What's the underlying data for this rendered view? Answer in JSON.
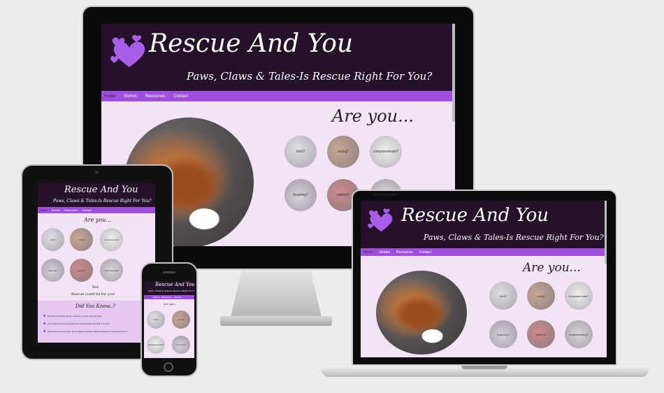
{
  "site": {
    "title": "Rescue And You",
    "tagline": "Paws, Claws & Tales-Is Rescue Right For You?",
    "nav": [
      "Home",
      "Stories",
      "Resources",
      "Contact"
    ],
    "are_you": "Are you...",
    "circles": [
      "kind?",
      "caring?",
      "compassionate?",
      "forgiving?",
      "patient?",
      "understanding?"
    ],
    "but": "But",
    "rescue_could_be": "Rescue could be for you!",
    "did_you_know": "Did You Know..?",
    "facts": [
      "All sorts of animals can be rescued, not just cats and dogs!",
      "Up to 20% of rescue animals are returned within the first 6 months!",
      "Rescues can be any age, from puppies to golden oldies looking for a retirement home!"
    ]
  },
  "colors": {
    "header_bg": "#25122a",
    "nav_bg": "#a04ede",
    "page_bg": "#f2e4f4",
    "heart": "#a85ee8"
  },
  "icons": [
    "heart-logo-icon",
    "camera-icon",
    "home-button-icon"
  ]
}
